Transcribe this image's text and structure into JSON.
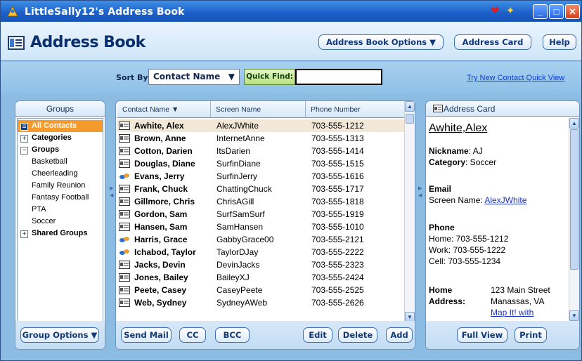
{
  "window": {
    "title": "LittleSally12's Address Book"
  },
  "header": {
    "title": "Address Book",
    "options_label": "Address Book Options",
    "address_card_label": "Address Card",
    "help_label": "Help"
  },
  "toolbar": {
    "sort_by_label": "Sort By:",
    "sort_value": "Contact Name",
    "quick_find_label": "Quick Find:",
    "quick_find_value": "",
    "try_link": "Try New Contact Quick View"
  },
  "groups": {
    "header": "Groups",
    "items": [
      {
        "label": "All Contacts",
        "selected": true,
        "bold": true,
        "icon": "address-book-icon"
      },
      {
        "label": "Categories",
        "bold": true,
        "icon": "expand-icon"
      },
      {
        "label": "Groups",
        "bold": true,
        "icon": "collapse-icon"
      },
      {
        "label": "Basketball",
        "child": true
      },
      {
        "label": "Cheerleading",
        "child": true
      },
      {
        "label": "Family Reunion",
        "child": true
      },
      {
        "label": "Fantasy Football",
        "child": true
      },
      {
        "label": "PTA",
        "child": true
      },
      {
        "label": "Soccer",
        "child": true
      },
      {
        "label": "Shared Groups",
        "bold": true,
        "icon": "expand-icon"
      }
    ],
    "footer_button": "Group Options"
  },
  "contacts": {
    "columns": {
      "name": "Contact Name",
      "screen": "Screen Name",
      "phone": "Phone Number"
    },
    "rows": [
      {
        "name": "Awhite, Alex",
        "screen": "AlexJWhite",
        "phone": "703-555-1212",
        "icon": "card-icon",
        "selected": true
      },
      {
        "name": "Brown, Anne",
        "screen": "InternetAnne",
        "phone": "703-555-1313",
        "icon": "card-icon"
      },
      {
        "name": "Cotton, Darien",
        "screen": "ItsDarien",
        "phone": "703-555-1414",
        "icon": "card-icon"
      },
      {
        "name": "Douglas, Diane",
        "screen": "SurfinDiane",
        "phone": "703-555-1515",
        "icon": "card-icon"
      },
      {
        "name": "Evans, Jerry",
        "screen": "SurfinJerry",
        "phone": "703-555-1616",
        "icon": "buddy-icon"
      },
      {
        "name": "Frank, Chuck",
        "screen": "ChattingChuck",
        "phone": "703-555-1717",
        "icon": "card-icon"
      },
      {
        "name": "Gillmore, Chris",
        "screen": "ChrisAGill",
        "phone": "703-555-1818",
        "icon": "card-icon"
      },
      {
        "name": "Gordon, Sam",
        "screen": "SurfSamSurf",
        "phone": "703-555-1919",
        "icon": "card-icon"
      },
      {
        "name": "Hansen, Sam",
        "screen": "SamHansen",
        "phone": "703-555-1010",
        "icon": "card-icon"
      },
      {
        "name": "Harris, Grace",
        "screen": "GabbyGrace00",
        "phone": "703-555-2121",
        "icon": "buddy-icon"
      },
      {
        "name": "Ichabod, Taylor",
        "screen": "TaylorDJay",
        "phone": "703-555-2222",
        "icon": "buddy-icon"
      },
      {
        "name": "Jacks, Devin",
        "screen": "DevinJacks",
        "phone": "703-555-2323",
        "icon": "card-icon"
      },
      {
        "name": "Jones, Bailey",
        "screen": "BaileyXJ",
        "phone": "703-555-2424",
        "icon": "card-icon"
      },
      {
        "name": "Peete, Casey",
        "screen": "CaseyPeete",
        "phone": "703-555-2525",
        "icon": "card-icon"
      },
      {
        "name": "Web, Sydney",
        "screen": "SydneyAWeb",
        "phone": "703-555-2626",
        "icon": "card-icon"
      }
    ],
    "footer": {
      "send_mail": "Send Mail",
      "cc": "CC",
      "bcc": "BCC",
      "edit": "Edit",
      "delete": "Delete",
      "add": "Add"
    }
  },
  "card": {
    "header": "Address Card",
    "name": "Awhite,Alex",
    "nickname_label": "Nickname",
    "nickname": ": AJ",
    "category_label": "Category",
    "category": ": Soccer",
    "email_heading": "Email",
    "screen_name_label": "Screen Name: ",
    "screen_name": "AlexJWhite",
    "phone_heading": "Phone",
    "home_phone": "Home: 703-555-1212",
    "work_phone": "Work: 703-555-1222",
    "cell_phone": "Cell: 703-555-1234",
    "home_label": "Home",
    "address_label": "Address:",
    "street": "123 Main Street",
    "city": "Manassas, VA",
    "map_link": "Map It! with",
    "full_view": "Full View",
    "print": "Print"
  },
  "colors": {
    "title_bar": "#1a5fc8",
    "selection": "#f59a2d",
    "accent": "#10387a"
  }
}
